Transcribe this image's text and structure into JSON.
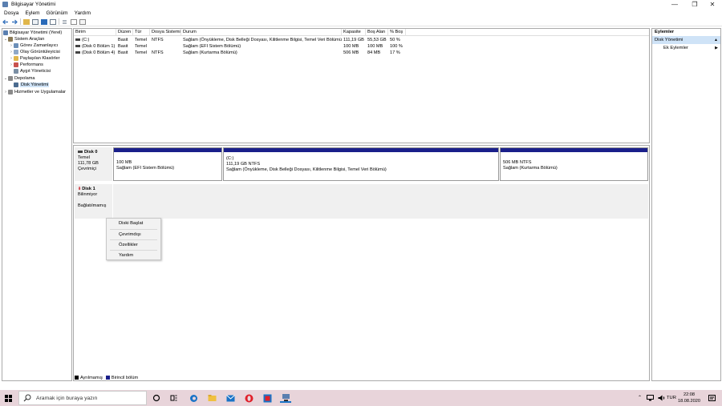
{
  "window": {
    "title": "Bilgisayar Yönetimi",
    "controls": {
      "minimize": "—",
      "maximize": "❐",
      "close": "✕"
    }
  },
  "menu": [
    "Dosya",
    "Eylem",
    "Görünüm",
    "Yardım"
  ],
  "tree": [
    {
      "label": "Bilgisayar Yönetimi (Yerel)",
      "expander": "",
      "color": "#5a7fb0"
    },
    {
      "label": "Sistem Araçları",
      "expander": "⌄",
      "color": "#8a7a56"
    },
    {
      "label": "Görev Zamanlayıcı",
      "expander": "›",
      "color": "#6c8fb8"
    },
    {
      "label": "Olay Görüntüleyicisi",
      "expander": "›",
      "color": "#8fa8c8"
    },
    {
      "label": "Paylaşılan Klasörler",
      "expander": "›",
      "color": "#e0b64b"
    },
    {
      "label": "Performans",
      "expander": "›",
      "color": "#c8524e"
    },
    {
      "label": "Aygıt Yöneticisi",
      "expander": "",
      "color": "#7b8fa4"
    },
    {
      "label": "Depolama",
      "expander": "⌄",
      "color": "#8a8a8a"
    },
    {
      "label": "Disk Yönetimi",
      "expander": "",
      "color": "#4b6b8f"
    },
    {
      "label": "Hizmetler ve Uygulamalar",
      "expander": "›",
      "color": "#8a8a8a"
    }
  ],
  "volumes": {
    "headers": [
      "Birim",
      "Düzen",
      "Tür",
      "Dosya Sistemi",
      "Durum",
      "Kapasite",
      "Boş Alan",
      "% Boş"
    ],
    "rows": [
      [
        "(C:)",
        "Basit",
        "Temel",
        "NTFS",
        "Sağlam (Önyükleme, Disk Belleği Dosyası, Kilitlenme Bilgisi, Temel Veri Bölümü)",
        "111,19 GB",
        "55,53 GB",
        "50 %"
      ],
      [
        "(Disk 0 Bölüm 1)",
        "Basit",
        "Temel",
        "",
        "Sağlam (EFI Sistem Bölümü)",
        "100 MB",
        "100 MB",
        "100 %"
      ],
      [
        "(Disk 0 Bölüm 4)",
        "Basit",
        "Temel",
        "NTFS",
        "Sağlam (Kurtarma Bölümü)",
        "506 MB",
        "84 MB",
        "17 %"
      ]
    ]
  },
  "disk0": {
    "name": "Disk 0",
    "type": "Temel",
    "size": "111,78 GB",
    "status": "Çevrimiçi",
    "partitions": [
      {
        "title": "",
        "line1": "100 MB",
        "line2": "Sağlam (EFI Sistem Bölümü)"
      },
      {
        "title": "(C:)",
        "line1": "111,19 GB NTFS",
        "line2": "Sağlam (Önyükleme, Disk Belleği Dosyası, Kilitlenme Bilgisi, Temel Veri Bölümü)"
      },
      {
        "title": "",
        "line1": "506 MB NTFS",
        "line2": "Sağlam (Kurtarma Bölümü)"
      }
    ]
  },
  "disk1": {
    "name": "Disk 1",
    "type": "Bilinmiyor",
    "status": "Bağlatılmamış"
  },
  "context_menu": [
    "Diski Başlat",
    "Çevrimdışı",
    "Özellikler",
    "Yardım"
  ],
  "legend": [
    {
      "label": "Ayrılmamış",
      "color": "#000000"
    },
    {
      "label": "Birincil bölüm",
      "color": "#1a1f8a"
    }
  ],
  "actions": {
    "header": "Eylemler",
    "section": "Disk Yönetimi",
    "item": "Ek Eylemler"
  },
  "taskbar": {
    "search_placeholder": "Aramak için buraya yazın",
    "language": "TUR",
    "time": "22:08",
    "date": "18.08.2020"
  },
  "colors": {
    "primary_partition": "#1a1f8a",
    "selection": "#cfe3f7",
    "taskbar": "#e8d4da"
  }
}
